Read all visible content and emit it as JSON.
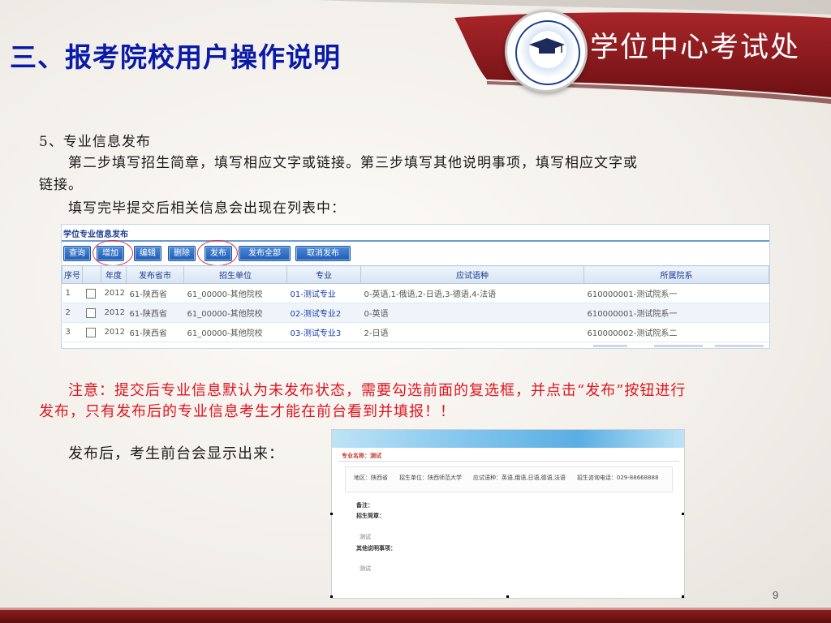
{
  "header": {
    "title": "三、报考院校用户操作说明",
    "org_name": "学位中心考试处"
  },
  "content": {
    "step_heading": "5、专业信息发布",
    "para_1": "第二步填写招生简章，填写相应文字或链接。第三步填写其他说明事项，填写相应文字或",
    "para_1_cont": "链接。",
    "para_2": "填写完毕提交后相关信息会出现在列表中：",
    "note_1": "注意：提交后专业信息默认为未发布状态，需要勾选前面的复选框，并点击“发布”按钮进行",
    "note_2": "发布，只有发布后的专业信息考生才能在前台看到并填报！！",
    "after_text": "发布后，考生前台会显示出来："
  },
  "table": {
    "title": "学位专业信息发布",
    "buttons": [
      "查询",
      "增加",
      "编辑",
      "删除",
      "发布",
      "发布全部",
      "取消发布"
    ],
    "headers": [
      "序号",
      "",
      "年度",
      "发布省市",
      "招生单位",
      "专业",
      "应试语种",
      "所属院系"
    ],
    "rows": [
      [
        "1",
        "",
        "2012",
        "61-陕西省",
        "61_00000-其他院校",
        "01-测试专业",
        "0-英语,1-俄语,2-日语,3-德语,4-法语",
        "610000001-测试院系一"
      ],
      [
        "2",
        "",
        "2012",
        "61-陕西省",
        "61_00000-其他院校",
        "02-测试专业2",
        "0-英语",
        "610000001-测试院系一"
      ],
      [
        "3",
        "",
        "2012",
        "61-陕西省",
        "61_00000-其他院校",
        "03-测试专业3",
        "2-日语",
        "610000002-测试院系二"
      ]
    ]
  },
  "preview": {
    "major_label": "专业名称：测试",
    "info_line": "地区：陕西省　　招生单位：陕西师范大学　　应试语种：英语,俄语,日语,德语,法语　　招生咨询电话：029-88668888",
    "remark_label": "备注：",
    "brochure_label": "招生简章：",
    "brochure_value": "测试",
    "other_label": "其他说明事项：",
    "other_value": "测试"
  },
  "footer": {
    "page_number": "9"
  },
  "colors": {
    "title_blue": "#0a1aa8",
    "header_red": "#8b1d1d",
    "note_red": "#e0141e"
  }
}
